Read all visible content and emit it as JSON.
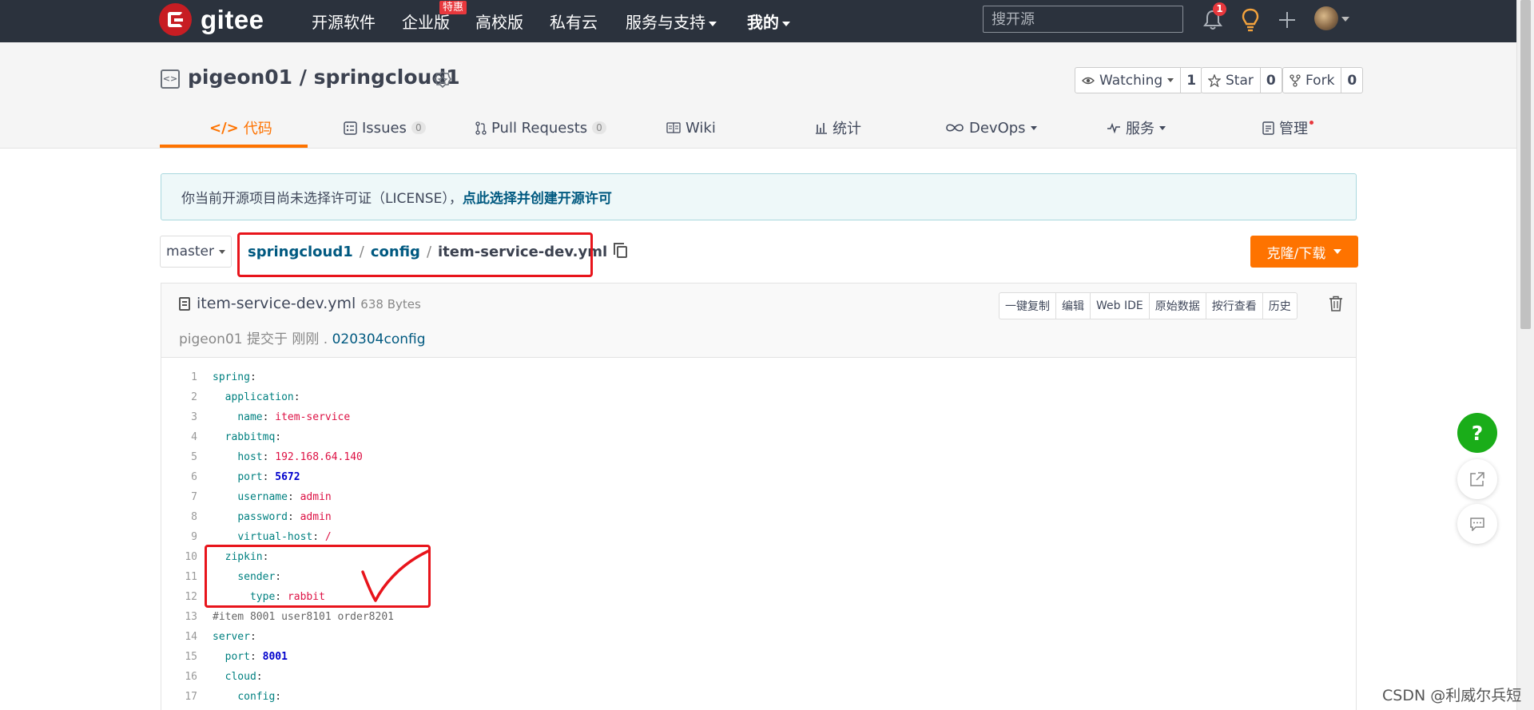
{
  "topnav": {
    "logo_text": "gitee",
    "items": [
      {
        "label": "开源软件"
      },
      {
        "label": "企业版",
        "badge": "特惠"
      },
      {
        "label": "高校版"
      },
      {
        "label": "私有云"
      },
      {
        "label": "服务与支持"
      },
      {
        "label": "我的"
      }
    ],
    "search_placeholder": "搜开源",
    "notification_count": "1"
  },
  "repo": {
    "title": "pigeon01 / springcloud1",
    "watch_label": "Watching",
    "watch_count": "1",
    "star_label": "Star",
    "star_count": "0",
    "fork_label": "Fork",
    "fork_count": "0"
  },
  "tabs": [
    {
      "label": "代码"
    },
    {
      "label": "Issues",
      "count": "0"
    },
    {
      "label": "Pull Requests",
      "count": "0"
    },
    {
      "label": "Wiki"
    },
    {
      "label": "统计"
    },
    {
      "label": "DevOps"
    },
    {
      "label": "服务"
    },
    {
      "label": "管理"
    }
  ],
  "notice": {
    "text": "你当前开源项目尚未选择许可证（LICENSE），",
    "link": "点此选择并创建开源许可"
  },
  "branch": "master",
  "breadcrumb": {
    "root": "springcloud1",
    "sep1": "/",
    "folder": "config",
    "sep2": "/",
    "file": "item-service-dev.yml"
  },
  "clone_label": "克隆/下载",
  "file": {
    "name": "item-service-dev.yml",
    "size": "638 Bytes",
    "commit_text": "pigeon01 提交于 刚刚 .",
    "commit_msg": "020304config",
    "actions": [
      "一键复制",
      "编辑",
      "Web IDE",
      "原始数据",
      "按行查看",
      "历史"
    ]
  },
  "code_lines": [
    {
      "n": "1",
      "indent": "",
      "key": "spring",
      "colon": ":",
      "value": "",
      "vtype": ""
    },
    {
      "n": "2",
      "indent": "  ",
      "key": "application",
      "colon": ":",
      "value": "",
      "vtype": ""
    },
    {
      "n": "3",
      "indent": "    ",
      "key": "name",
      "colon": ": ",
      "value": "item-service",
      "vtype": "s"
    },
    {
      "n": "4",
      "indent": "  ",
      "key": "rabbitmq",
      "colon": ":",
      "value": "",
      "vtype": ""
    },
    {
      "n": "5",
      "indent": "    ",
      "key": "host",
      "colon": ": ",
      "value": "192.168.64.140",
      "vtype": "s"
    },
    {
      "n": "6",
      "indent": "    ",
      "key": "port",
      "colon": ": ",
      "value": "5672",
      "vtype": "n"
    },
    {
      "n": "7",
      "indent": "    ",
      "key": "username",
      "colon": ": ",
      "value": "admin",
      "vtype": "s"
    },
    {
      "n": "8",
      "indent": "    ",
      "key": "password",
      "colon": ": ",
      "value": "admin",
      "vtype": "s"
    },
    {
      "n": "9",
      "indent": "    ",
      "key": "virtual-host",
      "colon": ": ",
      "value": "/",
      "vtype": "s"
    },
    {
      "n": "10",
      "indent": "  ",
      "key": "zipkin",
      "colon": ":",
      "value": "",
      "vtype": ""
    },
    {
      "n": "11",
      "indent": "    ",
      "key": "sender",
      "colon": ":",
      "value": "",
      "vtype": ""
    },
    {
      "n": "12",
      "indent": "      ",
      "key": "type",
      "colon": ": ",
      "value": "rabbit",
      "vtype": "s"
    },
    {
      "n": "13",
      "indent": "",
      "key": "",
      "colon": "",
      "value": "#item 8001 user8101 order8201",
      "vtype": "c"
    },
    {
      "n": "14",
      "indent": "",
      "key": "server",
      "colon": ":",
      "value": "",
      "vtype": ""
    },
    {
      "n": "15",
      "indent": "  ",
      "key": "port",
      "colon": ": ",
      "value": "8001",
      "vtype": "n"
    },
    {
      "n": "16",
      "indent": "  ",
      "key": "cloud",
      "colon": ":",
      "value": "",
      "vtype": ""
    },
    {
      "n": "17",
      "indent": "    ",
      "key": "config",
      "colon": ":",
      "value": "",
      "vtype": ""
    }
  ],
  "float": {
    "help": "?"
  },
  "watermark": "CSDN @利威尔兵短",
  "colors": {
    "accent": "#fe7300",
    "nav_bg": "#2b323d",
    "annotation": "#e8141b",
    "help_green": "#1aad19"
  }
}
